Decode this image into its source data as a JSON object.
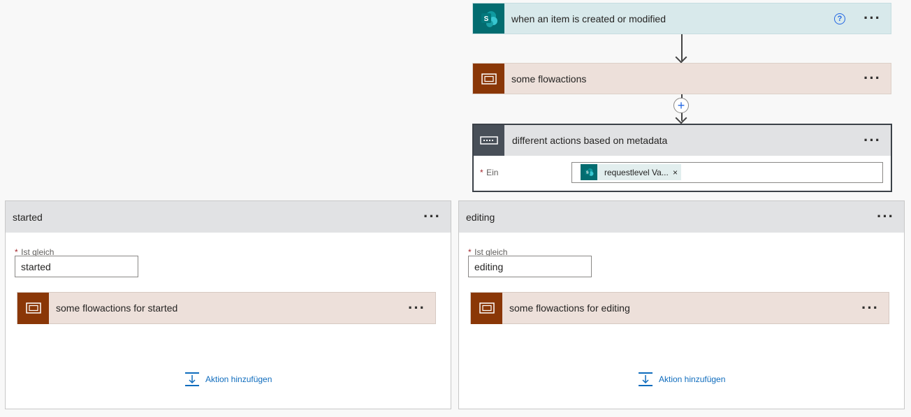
{
  "trigger": {
    "title": "when an item is created or modified",
    "icon": "sharepoint-icon",
    "help": "?"
  },
  "action1": {
    "title": "some flowactions",
    "icon": "scope-icon"
  },
  "switch": {
    "title": "different actions based on metadata",
    "icon": "switch-icon",
    "field_label": "Ein",
    "required_mark": "*",
    "token_text": "requestlevel Va...",
    "token_remove": "×"
  },
  "cases": [
    {
      "title": "started",
      "field_label": "Ist gleich",
      "required_mark": "*",
      "value": "started",
      "inner_action": "some flowactions for started",
      "add_action": "Aktion hinzufügen"
    },
    {
      "title": "editing",
      "field_label": "Ist gleich",
      "required_mark": "*",
      "value": "editing",
      "inner_action": "some flowactions for editing",
      "add_action": "Aktion hinzufügen"
    }
  ],
  "colors": {
    "sharepoint": "#036c70",
    "scope": "#8a3707",
    "switch": "#484f58",
    "link": "#0f6cbd"
  }
}
